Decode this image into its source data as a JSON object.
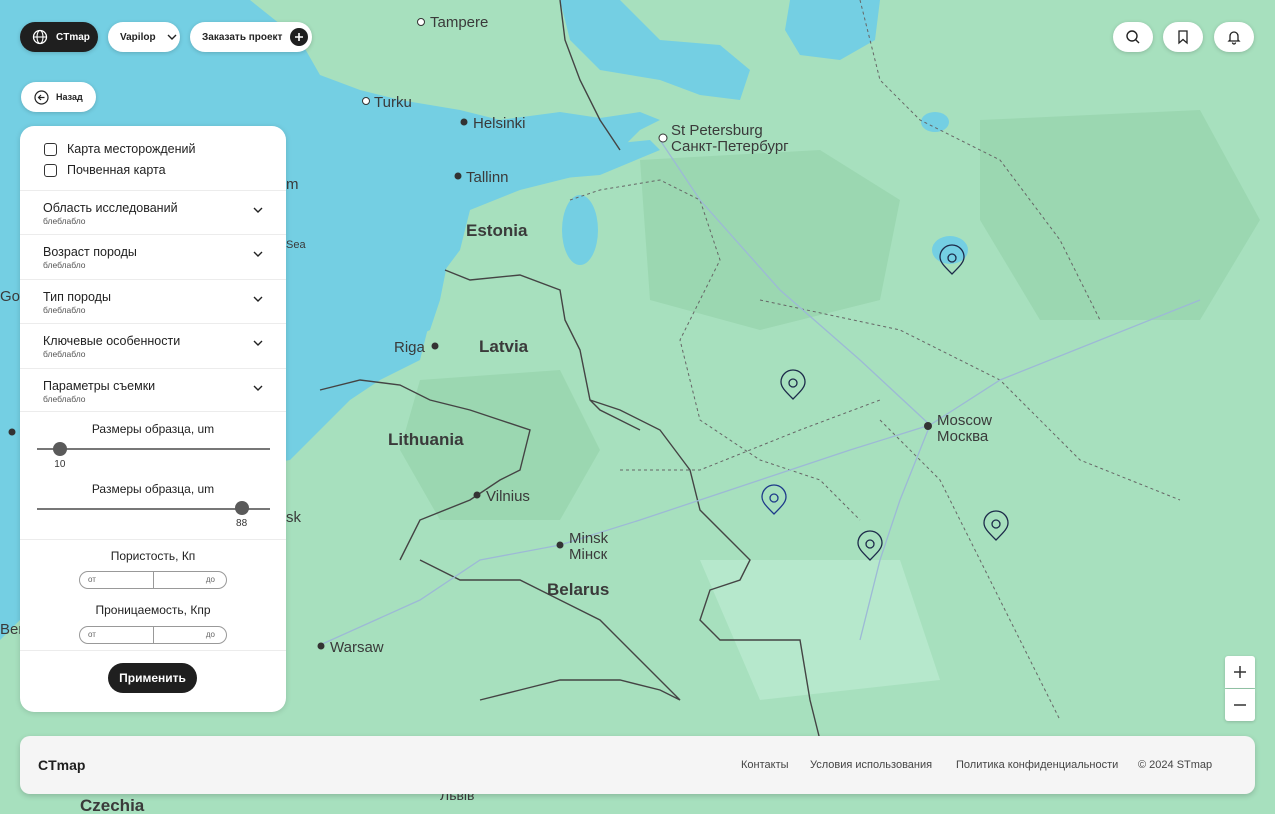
{
  "toolbar": {
    "app_button": "CTmap",
    "user_dropdown": "Vapilop",
    "order_button": "Заказать проект",
    "back_button": "Назад"
  },
  "filters": {
    "checkboxes": [
      "Карта месторождений",
      "Почвенная карта"
    ],
    "accordions": [
      {
        "title": "Область исследований",
        "subtitle": "блеблабло"
      },
      {
        "title": "Возраст породы",
        "subtitle": "блеблабло"
      },
      {
        "title": "Тип породы",
        "subtitle": "блеблабло"
      },
      {
        "title": "Ключевые особенности",
        "subtitle": "блеблабло"
      },
      {
        "title": "Параметры съемки",
        "subtitle": "блеблабло"
      }
    ],
    "slider1": {
      "title": "Размеры образца, um",
      "value": "10",
      "fraction": 0.1
    },
    "slider2": {
      "title": "Размеры образца, um",
      "value": "88",
      "fraction": 0.88
    },
    "porosity": {
      "title": "Пористость, Кп",
      "from": "от",
      "to": "до"
    },
    "permeability": {
      "title": "Проницаемость, Кпр",
      "from": "от",
      "to": "до"
    },
    "apply_button": "Применить"
  },
  "map": {
    "labels": {
      "tampere": "Tampere",
      "turku": "Turku",
      "helsinki": "Helsinki",
      "tallinn": "Tallinn",
      "st_petersburg_en": "St Petersburg",
      "st_petersburg_ru": "Санкт-Петербург",
      "estonia": "Estonia",
      "latvia": "Latvia",
      "riga": "Riga",
      "lithuania": "Lithuania",
      "vilnius": "Vilnius",
      "minsk_en": "Minsk",
      "minsk_ru": "Мінск",
      "belarus": "Belarus",
      "warsaw": "Warsaw",
      "moscow_en": "Moscow",
      "moscow_ru": "Москва",
      "czechia": "Czechia",
      "lviv": "Львів",
      "partial_m": "m",
      "partial_sea": "Sea",
      "partial_go": "Go",
      "partial_sk": "sk",
      "partial_berl": "Berl"
    }
  },
  "footer": {
    "brand": "CTmap",
    "links": [
      "Контакты",
      "Условия использования",
      "Политика конфиденциальности"
    ],
    "copyright": "© 2024 STmap"
  },
  "colors": {
    "land": "#a7e0be",
    "water": "#74cfe3",
    "accent_dark": "#1f1f1f",
    "marker_dark": "#1d2b4a",
    "marker_blue": "#1e3a8a"
  }
}
